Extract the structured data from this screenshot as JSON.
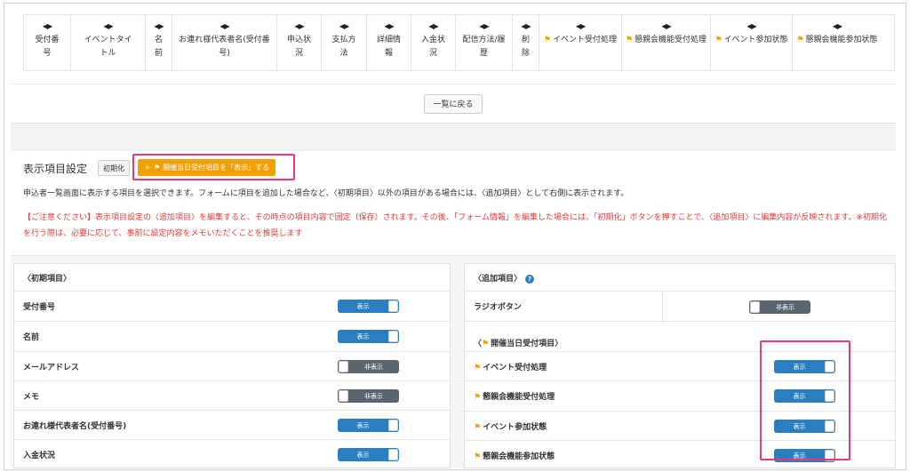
{
  "header": {
    "sort_glyph": "◆",
    "columns": [
      {
        "label": "受付番号",
        "flag": false
      },
      {
        "label": "イベントタイトル",
        "flag": false
      },
      {
        "label": "名前",
        "flag": false
      },
      {
        "label": "お連れ様代表者名(受付番号)",
        "flag": false
      },
      {
        "label": "申込状況",
        "flag": false
      },
      {
        "label": "支払方法",
        "flag": false
      },
      {
        "label": "詳細情報",
        "flag": false
      },
      {
        "label": "入金状況",
        "flag": false
      },
      {
        "label": "配信方法/履歴",
        "flag": false
      },
      {
        "label": "削除",
        "flag": false
      },
      {
        "label": "イベント受付処理",
        "flag": true
      },
      {
        "label": "懇親会機能受付処理",
        "flag": true
      },
      {
        "label": "イベント参加状態",
        "flag": true
      },
      {
        "label": "懇親会機能参加状態",
        "flag": true
      }
    ]
  },
  "back_button": "一覧に戻る",
  "settings": {
    "title": "表示項目設定",
    "init_button": "初期化",
    "show_button": "開催当日受付項目を「表示」する",
    "description": "申込者一覧画面に表示する項目を選択できます。フォームに項目を追加した場合など、〈初期項目〉以外の項目がある場合には、〈追加項目〉として右側に表示されます。",
    "warning": "【ご注意ください】表示項目設定の〈追加項目〉を編集すると、その時点の項目内容で固定（保存）されます。その後、「フォーム情報」を編集した場合には、「初期化」ボタンを押すことで、〈追加項目〉に編集内容が反映されます。※初期化を行う際は、必要に応じて、事前に設定内容をメモいただくことを推奨します"
  },
  "initial_items": {
    "title": "〈初期項目〉",
    "rows": [
      {
        "label": "受付番号",
        "state": "表示",
        "on": true
      },
      {
        "label": "名前",
        "state": "表示",
        "on": true
      },
      {
        "label": "メールアドレス",
        "state": "非表示",
        "on": false
      },
      {
        "label": "メモ",
        "state": "非表示",
        "on": false
      },
      {
        "label": "お連れ様代表者名(受付番号)",
        "state": "表示",
        "on": true
      },
      {
        "label": "入金状況",
        "state": "表示",
        "on": true
      }
    ]
  },
  "additional_items": {
    "title": "〈追加項目〉",
    "help": "?",
    "rows": [
      {
        "label": "ラジオボタン",
        "state": "非表示",
        "on": false
      }
    ]
  },
  "event_day_items": {
    "title": "開催当日受付項目",
    "open": "〈",
    "close": "〉",
    "rows": [
      {
        "label": "イベント受付処理",
        "state": "表示",
        "on": true
      },
      {
        "label": "懇親会機能受付処理",
        "state": "表示",
        "on": true
      },
      {
        "label": "イベント参加状態",
        "state": "表示",
        "on": true
      },
      {
        "label": "懇親会機能参加状態",
        "state": "表示",
        "on": true
      }
    ]
  },
  "colors": {
    "accent_blue": "#2b7fc1",
    "orange": "#f0a000",
    "warning_red": "#e33b3b",
    "highlight_pink": "#e6397a"
  }
}
